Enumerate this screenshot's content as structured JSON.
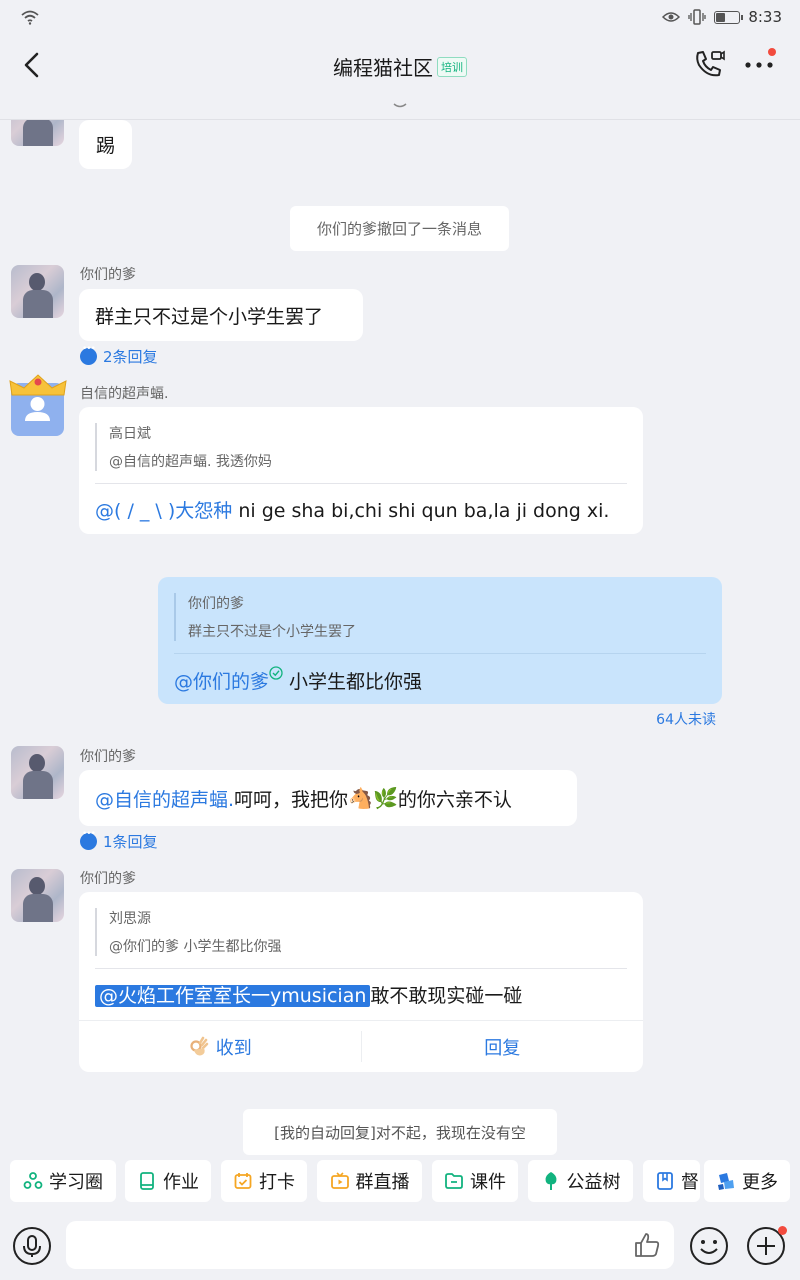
{
  "status_bar": {
    "time": "8:33"
  },
  "header": {
    "title": "编程猫社区",
    "tag": "培训"
  },
  "messages": {
    "m1_text": "踢",
    "recall_notice": "你们的爹撤回了一条消息",
    "m2": {
      "sender": "你们的爹",
      "text": "群主只不过是个小学生罢了",
      "thread": "2条回复"
    },
    "m3": {
      "sender": "自信的超声蝠.",
      "quote_name": "高日斌",
      "quote_text": "@自信的超声蝠. 我透你妈",
      "mention": "@( / _ \\ )大怨种",
      "text": " ni ge sha bi,chi shi qun ba,la ji dong xi."
    },
    "m4": {
      "quote_name": "你们的爹",
      "quote_text": "群主只不过是个小学生罢了",
      "mention": "@你们的爹",
      "text": " 小学生都比你强",
      "unread": "64人未读"
    },
    "m5": {
      "sender": "你们的爹",
      "mention": "@自信的超声蝠.",
      "text_before": " 呵呵，我把你",
      "emoji": "🐴🌿",
      "text_after": "的你六亲不认",
      "thread": "1条回复"
    },
    "m6": {
      "sender": "你们的爹",
      "quote_name": "刘思源",
      "quote_text": "@你们的爹 小学生都比你强",
      "mention": "@火焰工作室室长一ymusician",
      "text": "敢不敢现实碰一碰",
      "action_received": "收到",
      "action_reply": "回复"
    },
    "auto_reply": "[我的自动回复]对不起，我现在没有空"
  },
  "toolbar": {
    "items": [
      {
        "label": "学习圈",
        "icon": "circle-icon",
        "color": "#12b37f"
      },
      {
        "label": "作业",
        "icon": "homework-icon",
        "color": "#12b37f"
      },
      {
        "label": "打卡",
        "icon": "checkin-icon",
        "color": "#f5a623"
      },
      {
        "label": "群直播",
        "icon": "live-icon",
        "color": "#f5a623"
      },
      {
        "label": "课件",
        "icon": "folder-icon",
        "color": "#12b37f"
      },
      {
        "label": "公益树",
        "icon": "tree-icon",
        "color": "#12b37f"
      },
      {
        "label": "督",
        "icon": "book-icon",
        "color": "#2b79e0"
      },
      {
        "label": "更多",
        "icon": "more-apps-icon",
        "color": "#2b79e0"
      }
    ]
  },
  "composer": {
    "placeholder": ""
  },
  "colors": {
    "accent": "#2b79e0",
    "green": "#12b37f",
    "notify": "#f24b3e"
  }
}
